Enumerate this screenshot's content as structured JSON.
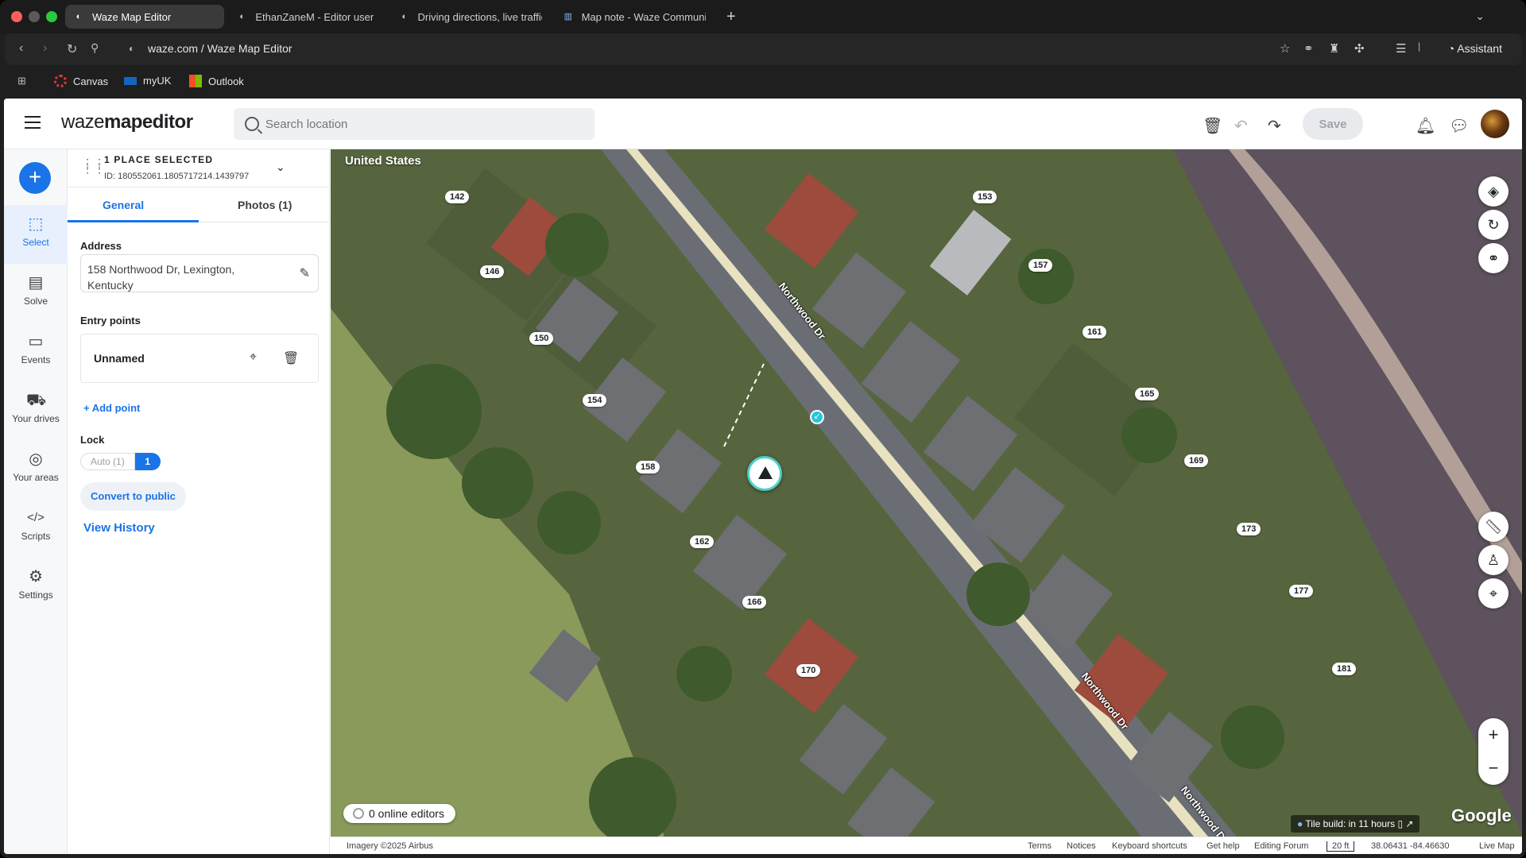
{
  "browser": {
    "tabs": [
      {
        "title": "Waze Map Editor",
        "icon": "waze-icon",
        "active": true
      },
      {
        "title": "EthanZaneM - Editor user p",
        "icon": "waze-icon",
        "active": false
      },
      {
        "title": "Driving directions, live traffic",
        "icon": "waze-icon",
        "active": false
      },
      {
        "title": "Map note - Waze Communit",
        "icon": "community-icon",
        "active": false
      }
    ],
    "url": "waze.com / Waze Map Editor",
    "assistant_label": "Assistant",
    "bookmarks": [
      {
        "label": "Canvas",
        "icon": "canvas-icon",
        "color": "#e53935"
      },
      {
        "label": "myUK",
        "icon": "sap-icon",
        "color": "#1565c0"
      },
      {
        "label": "Outlook",
        "icon": "microsoft-icon",
        "color": "#f25022"
      }
    ]
  },
  "header": {
    "logo_light": "waze",
    "logo_bold": "mapeditor",
    "search_placeholder": "Search location",
    "save_label": "Save"
  },
  "leftnav": [
    {
      "label": "Select",
      "icon": "select-icon",
      "active": true
    },
    {
      "label": "Solve",
      "icon": "solve-icon",
      "active": false
    },
    {
      "label": "Events",
      "icon": "calendar-icon",
      "active": false
    },
    {
      "label": "Your drives",
      "icon": "car-icon",
      "active": false
    },
    {
      "label": "Your areas",
      "icon": "globe-icon",
      "active": false
    },
    {
      "label": "Scripts",
      "icon": "code-icon",
      "active": false
    },
    {
      "label": "Settings",
      "icon": "gear-icon",
      "active": false
    }
  ],
  "panel": {
    "title": "1 PLACE SELECTED",
    "id_text": "ID: 180552061.1805717214.1439797",
    "tabs": [
      "General",
      "Photos (1)"
    ],
    "address_label": "Address",
    "address_value": "158 Northwood Dr, Lexington, Kentucky",
    "entry_points_label": "Entry points",
    "entry_name": "Unnamed",
    "add_point": "+ Add point",
    "lock_label": "Lock",
    "lock_auto": "Auto (1)",
    "lock_value": "1",
    "convert_label": "Convert to public",
    "history_label": "View History"
  },
  "map": {
    "country": "United States",
    "street": "Northwood Dr",
    "house_numbers": [
      "142",
      "146",
      "150",
      "153",
      "154",
      "157",
      "158",
      "161",
      "162",
      "165",
      "166",
      "169",
      "170",
      "173",
      "177",
      "181"
    ],
    "online_editors": "0 online editors",
    "tile_build": "Tile build: in 11 hours",
    "google": "Google"
  },
  "footer": {
    "imagery": "Imagery ©2025 Airbus",
    "terms": "Terms",
    "notices": "Notices",
    "shortcuts": "Keyboard shortcuts",
    "help": "Get help",
    "forum": "Editing Forum",
    "scale": "20 ft",
    "coords": "38.06431 -84.46630",
    "livemap": "Live Map"
  },
  "colors": {
    "accent": "#1a73e8",
    "marker_ring": "#4dd0c8"
  }
}
